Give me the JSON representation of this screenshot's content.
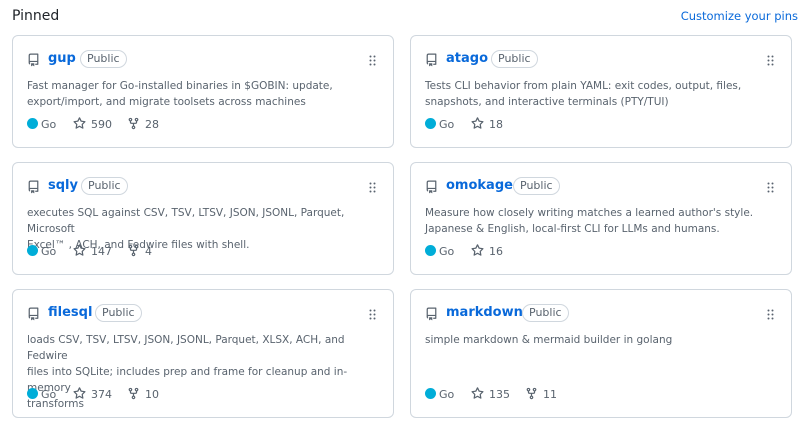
{
  "header": {
    "title": "Pinned",
    "customize_label": "Customize your pins"
  },
  "language_color": "#00ADD8",
  "link_color": "#0969da",
  "icons": {
    "repo": "repo-icon",
    "star": "star-icon",
    "fork": "fork-icon",
    "grabber": "grabber-icon"
  },
  "cards": [
    {
      "name": "gup",
      "visibility": "Public",
      "desc": [
        "Fast manager for Go-installed binaries in $GOBIN: update,",
        "export/import, and migrate toolsets across machines"
      ],
      "language": "Go",
      "stars": "590",
      "forks": "28"
    },
    {
      "name": "atago",
      "visibility": "Public",
      "desc": [
        "Tests CLI behavior from plain YAML: exit codes, output, files,",
        "snapshots, and interactive terminals (PTY/TUI)"
      ],
      "language": "Go",
      "stars": "18"
    },
    {
      "name": "sqly",
      "visibility": "Public",
      "desc": [
        "executes SQL against CSV, TSV, LTSV, JSON, JSONL, Parquet, Microsoft",
        "Excel™ , ACH, and Fedwire files with shell."
      ],
      "language": "Go",
      "stars": "147",
      "forks": "4"
    },
    {
      "name": "omokage",
      "visibility": "Public",
      "desc": [
        "Measure how closely writing matches a learned author's style.",
        "Japanese & English, local-first CLI for LLMs and humans."
      ],
      "language": "Go",
      "stars": "16"
    },
    {
      "name": "filesql",
      "visibility": "Public",
      "desc": [
        "loads CSV, TSV, LTSV, JSON, JSONL, Parquet, XLSX, ACH, and Fedwire",
        "files into SQLite; includes prep and frame for cleanup and in-memory",
        "transforms"
      ],
      "language": "Go",
      "stars": "374",
      "forks": "10"
    },
    {
      "name": "markdown",
      "visibility": "Public",
      "desc": [
        "simple markdown & mermaid builder in golang"
      ],
      "language": "Go",
      "stars": "135",
      "forks": "11"
    }
  ]
}
